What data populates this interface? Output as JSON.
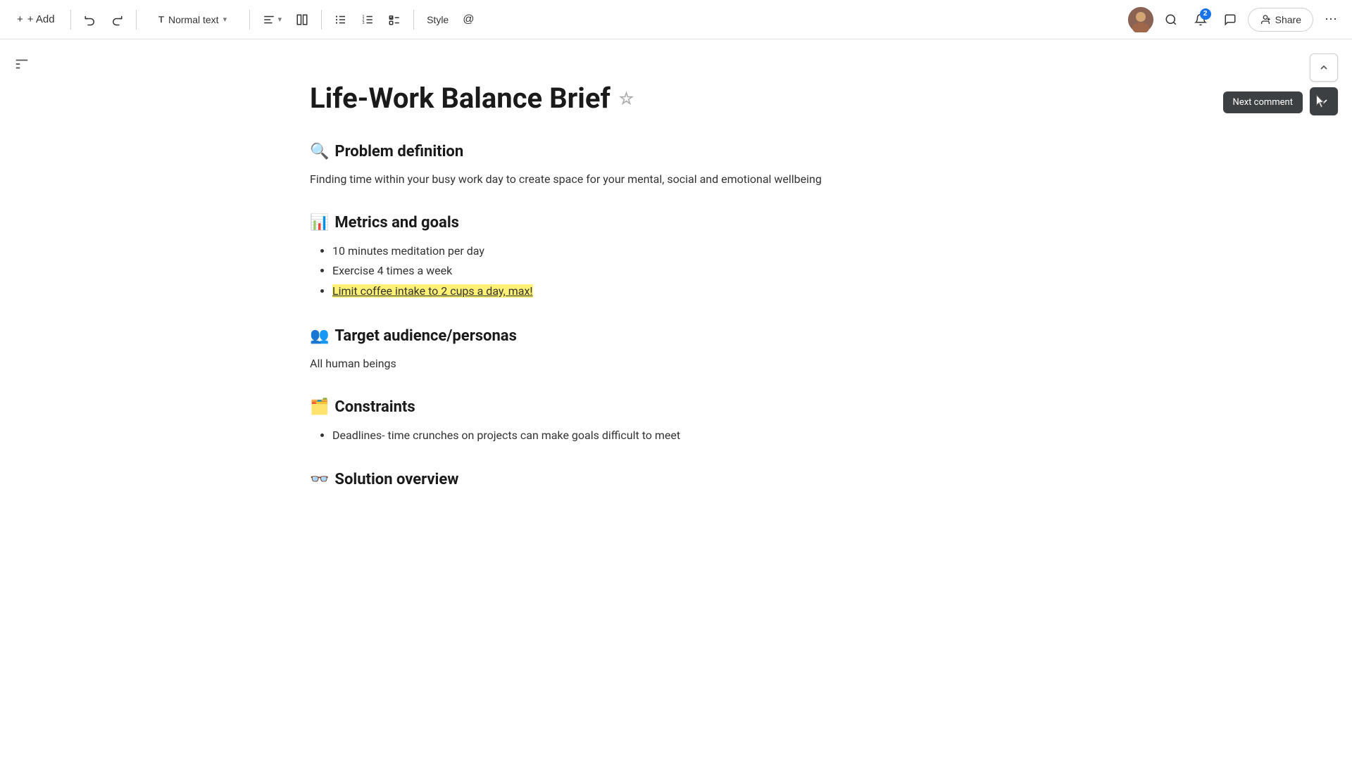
{
  "toolbar": {
    "add_label": "+ Add",
    "text_style": "Normal text",
    "style_label": "Style",
    "share_label": "Share",
    "notification_count": "2"
  },
  "document": {
    "title": "Life-Work Balance Brief",
    "sections": [
      {
        "id": "problem",
        "emoji": "🔍",
        "heading": "Problem definition",
        "content": "Finding time within your busy work day to create space for your mental, social and emotional wellbeing",
        "has_bullets": false
      },
      {
        "id": "metrics",
        "emoji": "📊",
        "heading": "Metrics and goals",
        "content": "",
        "has_bullets": true,
        "bullets": [
          {
            "text": "10 minutes meditation per day",
            "highlighted": false
          },
          {
            "text": "Exercise 4 times a week",
            "highlighted": false
          },
          {
            "text": "Limit coffee intake to 2 cups a day, max!",
            "highlighted": true
          }
        ]
      },
      {
        "id": "audience",
        "emoji": "👥",
        "heading": "Target audience/personas",
        "content": "All human beings",
        "has_bullets": false
      },
      {
        "id": "constraints",
        "emoji": "🗂️",
        "heading": "Constraints",
        "content": "",
        "has_bullets": true,
        "bullets": [
          {
            "text": "Deadlines- time crunches on projects can make goals difficult to meet",
            "highlighted": false
          }
        ]
      },
      {
        "id": "solution",
        "emoji": "👓",
        "heading": "Solution overview",
        "content": "",
        "has_bullets": false
      }
    ]
  },
  "tooltip": {
    "next_comment_label": "Next comment"
  },
  "icons": {
    "add": "+",
    "undo": "↩",
    "redo": "↪",
    "text": "T",
    "chevron_down": "▾",
    "align": "≡",
    "columns": "⊞",
    "bullets": "≔",
    "numbered": "≔",
    "checklist": "☑",
    "mention": "@",
    "more": "⋯",
    "share_person": "👤",
    "search": "🔍",
    "comments": "💬",
    "star": "☆",
    "chevron_up": "∧",
    "chevron_down_nav": "∨",
    "sidebar": "☰"
  }
}
